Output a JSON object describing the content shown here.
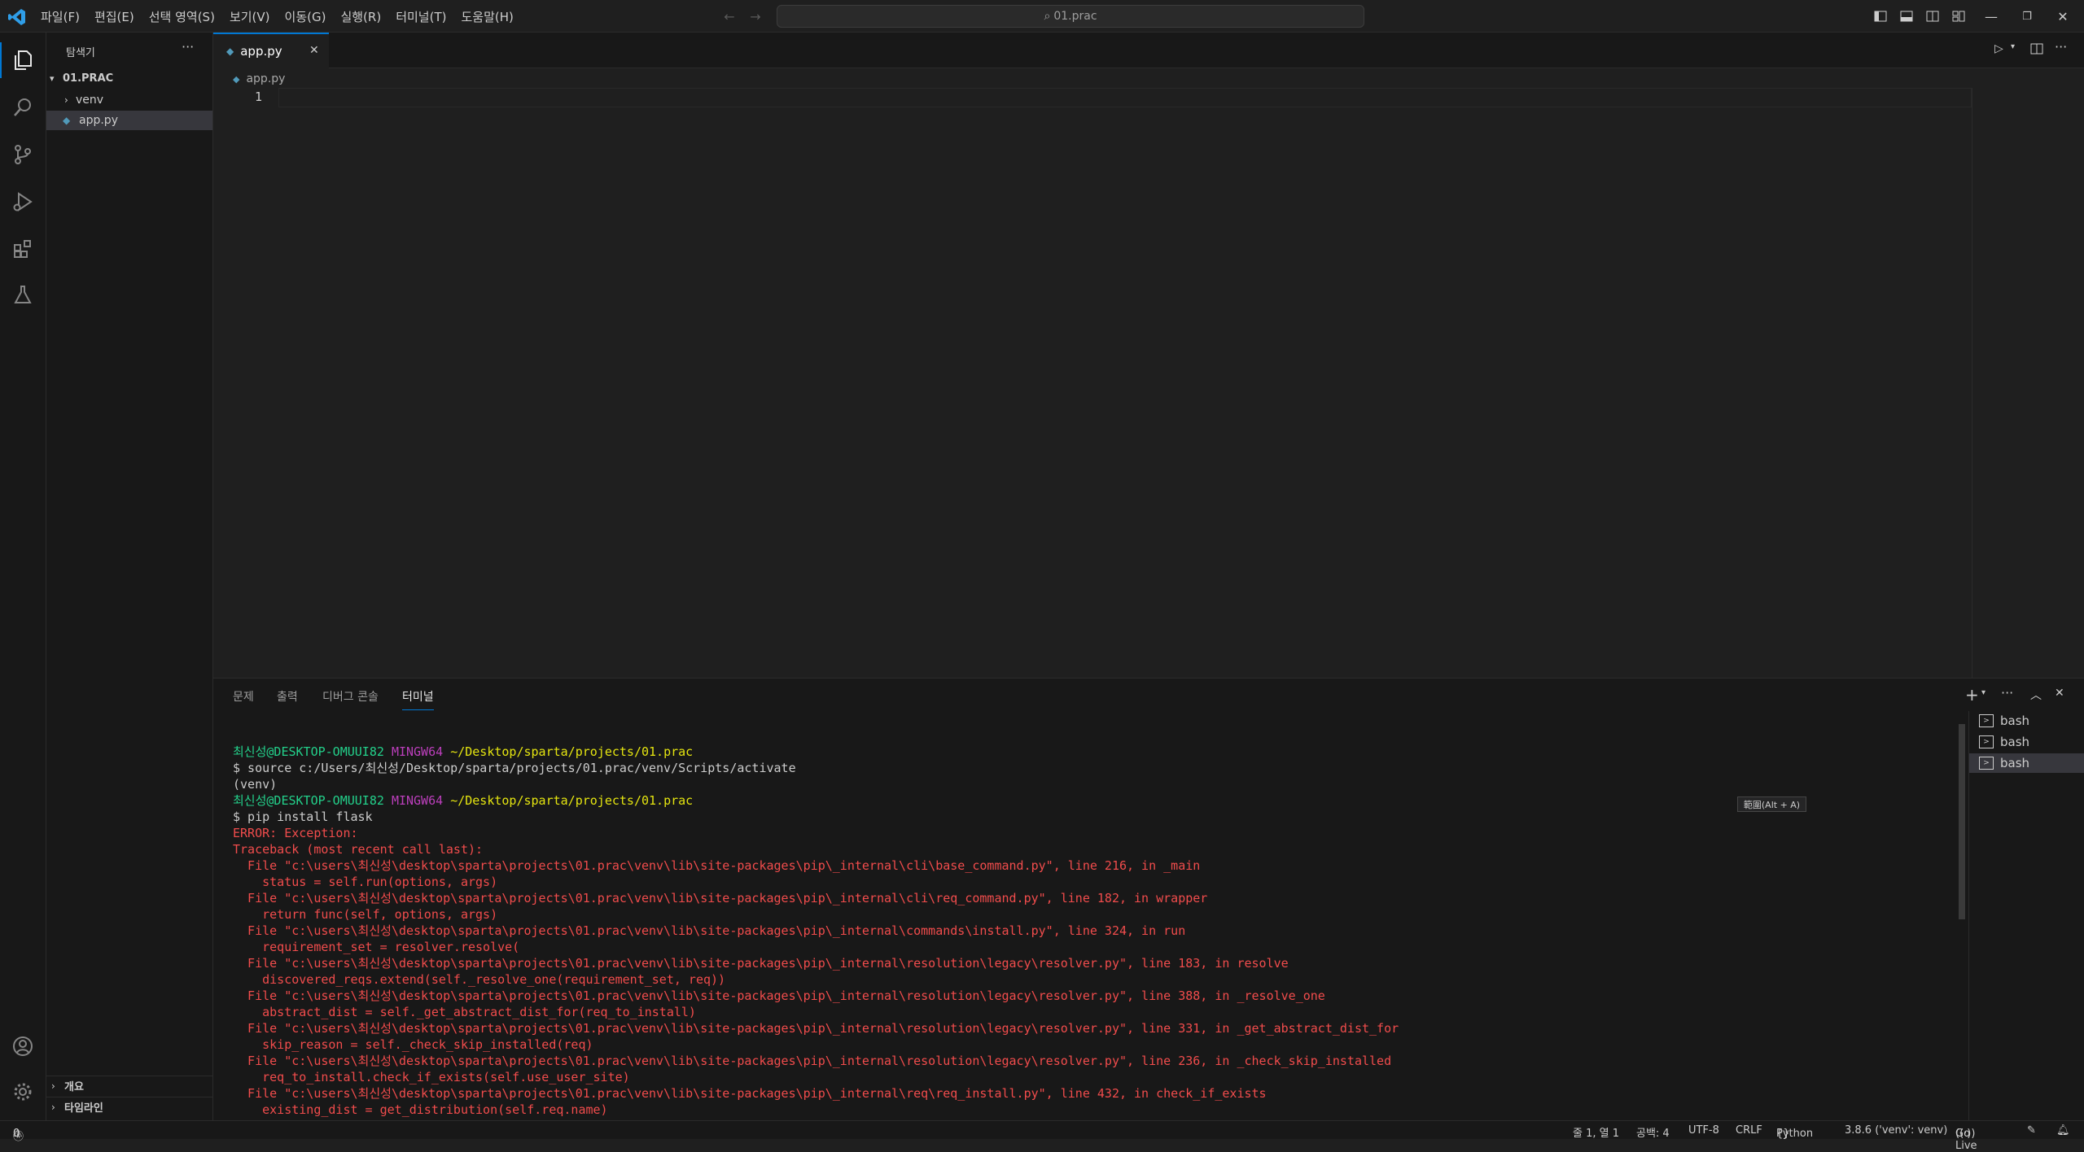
{
  "titlebar": {
    "menu": [
      "파일(F)",
      "편집(E)",
      "선택 영역(S)",
      "보기(V)",
      "이동(G)",
      "실행(R)",
      "터미널(T)",
      "도움말(H)"
    ],
    "search_text": "01.prac"
  },
  "sidebar": {
    "title": "탐색기",
    "folder": "01.PRAC",
    "items": [
      {
        "label": "venv",
        "type": "folder"
      },
      {
        "label": "app.py",
        "type": "file",
        "selected": true
      }
    ],
    "outline_label": "개요",
    "timeline_label": "타임라인"
  },
  "editor": {
    "tab_label": "app.py",
    "breadcrumb": "app.py",
    "line_number": "1"
  },
  "panel": {
    "tabs": [
      "문제",
      "출력",
      "디버그 콘솔",
      "터미널"
    ],
    "active_tab": "터미널",
    "terminals": [
      "bash",
      "bash",
      "bash"
    ],
    "tooltip": "範圍(Alt + A)",
    "terminal_lines": [
      {
        "parts": [
          [
            "최신성@DESKTOP-OMUUI82",
            "green"
          ],
          [
            " ",
            "white"
          ],
          [
            "MINGW64",
            "mag"
          ],
          [
            " ",
            "white"
          ],
          [
            "~/Desktop/sparta/projects/01.prac",
            "yel"
          ]
        ]
      },
      {
        "parts": [
          [
            "$ source c:/Users/최신성/Desktop/sparta/projects/01.prac/venv/Scripts/activate",
            "white"
          ]
        ]
      },
      {
        "parts": [
          [
            "(venv)",
            "white"
          ]
        ]
      },
      {
        "parts": [
          [
            "최신성@DESKTOP-OMUUI82",
            "green"
          ],
          [
            " ",
            "white"
          ],
          [
            "MINGW64",
            "mag"
          ],
          [
            " ",
            "white"
          ],
          [
            "~/Desktop/sparta/projects/01.prac",
            "yel"
          ]
        ]
      },
      {
        "parts": [
          [
            "$ pip install flask",
            "white"
          ]
        ]
      },
      {
        "parts": [
          [
            "ERROR: Exception:",
            "red"
          ]
        ]
      },
      {
        "parts": [
          [
            "Traceback (most recent call last):",
            "red"
          ]
        ]
      },
      {
        "parts": [
          [
            "  File \"c:\\users\\최신성\\desktop\\sparta\\projects\\01.prac\\venv\\lib\\site-packages\\pip\\_internal\\cli\\base_command.py\", line 216, in _main",
            "red"
          ]
        ]
      },
      {
        "parts": [
          [
            "    status = self.run(options, args)",
            "red"
          ]
        ]
      },
      {
        "parts": [
          [
            "  File \"c:\\users\\최신성\\desktop\\sparta\\projects\\01.prac\\venv\\lib\\site-packages\\pip\\_internal\\cli\\req_command.py\", line 182, in wrapper",
            "red"
          ]
        ]
      },
      {
        "parts": [
          [
            "    return func(self, options, args)",
            "red"
          ]
        ]
      },
      {
        "parts": [
          [
            "  File \"c:\\users\\최신성\\desktop\\sparta\\projects\\01.prac\\venv\\lib\\site-packages\\pip\\_internal\\commands\\install.py\", line 324, in run",
            "red"
          ]
        ]
      },
      {
        "parts": [
          [
            "    requirement_set = resolver.resolve(",
            "red"
          ]
        ]
      },
      {
        "parts": [
          [
            "  File \"c:\\users\\최신성\\desktop\\sparta\\projects\\01.prac\\venv\\lib\\site-packages\\pip\\_internal\\resolution\\legacy\\resolver.py\", line 183, in resolve",
            "red"
          ]
        ]
      },
      {
        "parts": [
          [
            "    discovered_reqs.extend(self._resolve_one(requirement_set, req))",
            "red"
          ]
        ]
      },
      {
        "parts": [
          [
            "  File \"c:\\users\\최신성\\desktop\\sparta\\projects\\01.prac\\venv\\lib\\site-packages\\pip\\_internal\\resolution\\legacy\\resolver.py\", line 388, in _resolve_one",
            "red"
          ]
        ]
      },
      {
        "parts": [
          [
            "    abstract_dist = self._get_abstract_dist_for(req_to_install)",
            "red"
          ]
        ]
      },
      {
        "parts": [
          [
            "  File \"c:\\users\\최신성\\desktop\\sparta\\projects\\01.prac\\venv\\lib\\site-packages\\pip\\_internal\\resolution\\legacy\\resolver.py\", line 331, in _get_abstract_dist_for",
            "red"
          ]
        ]
      },
      {
        "parts": [
          [
            "    skip_reason = self._check_skip_installed(req)",
            "red"
          ]
        ]
      },
      {
        "parts": [
          [
            "  File \"c:\\users\\최신성\\desktop\\sparta\\projects\\01.prac\\venv\\lib\\site-packages\\pip\\_internal\\resolution\\legacy\\resolver.py\", line 236, in _check_skip_installed",
            "red"
          ]
        ]
      },
      {
        "parts": [
          [
            "    req_to_install.check_if_exists(self.use_user_site)",
            "red"
          ]
        ]
      },
      {
        "parts": [
          [
            "  File \"c:\\users\\최신성\\desktop\\sparta\\projects\\01.prac\\venv\\lib\\site-packages\\pip\\_internal\\req\\req_install.py\", line 432, in check_if_exists",
            "red"
          ]
        ]
      },
      {
        "parts": [
          [
            "    existing_dist = get_distribution(self.req.name)",
            "red"
          ]
        ]
      }
    ]
  },
  "status": {
    "errors": "0",
    "warnings": "0",
    "position": "줄 1, 열 1",
    "spaces": "공백: 4",
    "encoding": "UTF-8",
    "eol": "CRLF",
    "language": "Python",
    "interpreter": "3.8.6 ('venv': venv)",
    "golive": "Go Live"
  },
  "colors": {
    "accent": "#0078d4",
    "python_icon": "#519aba",
    "error_text": "#f14c4c"
  }
}
